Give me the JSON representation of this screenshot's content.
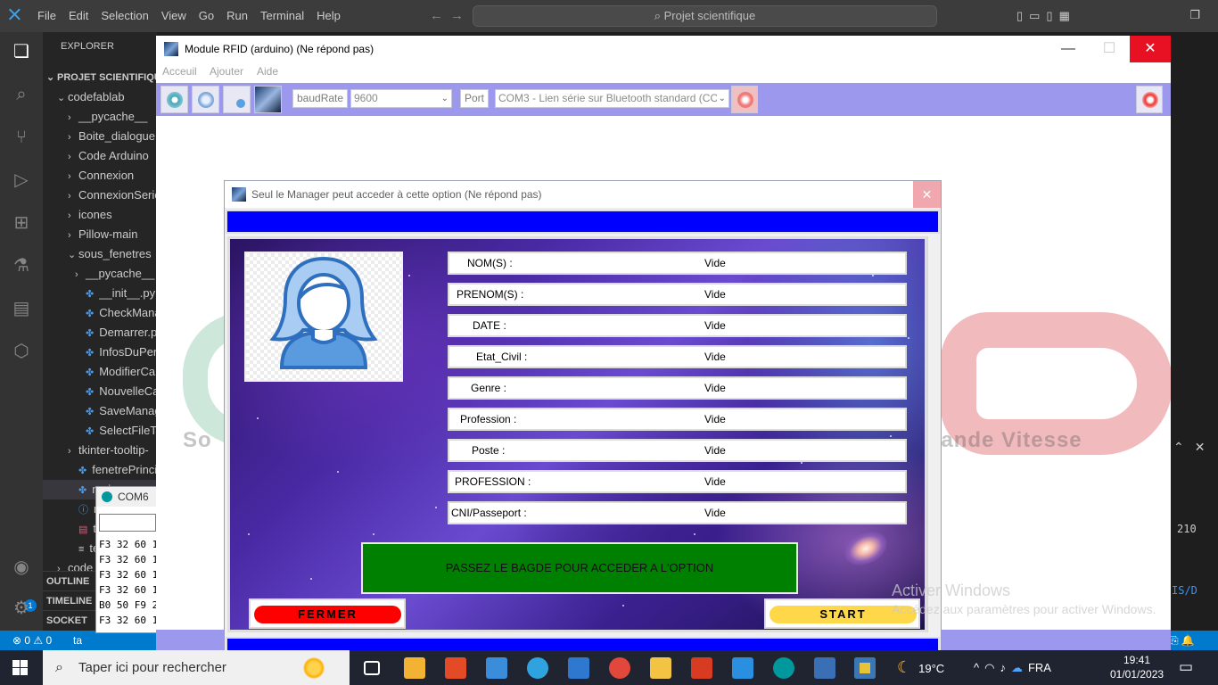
{
  "vscode": {
    "menu": [
      "File",
      "Edit",
      "Selection",
      "View",
      "Go",
      "Run",
      "Terminal",
      "Help"
    ],
    "search_text": "Projet scientifique",
    "explorer_header": "EXPLORER",
    "tree": [
      {
        "label": "PROJET SCIENTIFIQUE",
        "chev": "⌄",
        "indent": 4,
        "bold": true
      },
      {
        "label": "codefablab",
        "chev": "⌄",
        "indent": 16
      },
      {
        "label": "__pycache__",
        "chev": "›",
        "indent": 28
      },
      {
        "label": "Boite_dialogue",
        "chev": "›",
        "indent": 28
      },
      {
        "label": "Code Arduino",
        "chev": "›",
        "indent": 28
      },
      {
        "label": "Connexion",
        "chev": "›",
        "indent": 28
      },
      {
        "label": "ConnexionSerie",
        "chev": "›",
        "indent": 28
      },
      {
        "label": "icones",
        "chev": "›",
        "indent": 28
      },
      {
        "label": "Pillow-main",
        "chev": "›",
        "indent": 28
      },
      {
        "label": "sous_fenetres",
        "chev": "⌄",
        "indent": 28
      },
      {
        "label": "__pycache__",
        "chev": "›",
        "indent": 36
      },
      {
        "label": "__init__.py",
        "chev": "",
        "indent": 36,
        "py": true
      },
      {
        "label": "CheckManager",
        "chev": "",
        "indent": 36,
        "py": true
      },
      {
        "label": "Demarrer.py",
        "chev": "",
        "indent": 36,
        "py": true
      },
      {
        "label": "InfosDuPerso",
        "chev": "",
        "indent": 36,
        "py": true
      },
      {
        "label": "ModifierCarte",
        "chev": "",
        "indent": 36,
        "py": true
      },
      {
        "label": "NouvelleCarte",
        "chev": "",
        "indent": 36,
        "py": true
      },
      {
        "label": "SaveManager",
        "chev": "",
        "indent": 36,
        "py": true
      },
      {
        "label": "SelectFileToRe",
        "chev": "",
        "indent": 36,
        "py": true
      },
      {
        "label": "tkinter-tooltip-",
        "chev": "›",
        "indent": 28
      },
      {
        "label": "fenetrePrincipa",
        "chev": "",
        "indent": 28,
        "py": true
      },
      {
        "label": "main.py",
        "chev": "",
        "indent": 28,
        "py": true,
        "selected": true
      },
      {
        "label": "rea",
        "chev": "",
        "indent": 28,
        "info": true
      },
      {
        "label": "tes",
        "chev": "",
        "indent": 28,
        "db": true
      },
      {
        "label": "tes",
        "chev": "",
        "indent": 28,
        "lines": true
      },
      {
        "label": "code",
        "chev": "›",
        "indent": 16
      }
    ],
    "sections": [
      "OUTLINE",
      "TIMELINE",
      "SOCKET"
    ],
    "status_left": "⊗ 0 ⚠ 0",
    "status_extra": "ta",
    "panel_number": "210",
    "panel_link": "IS/D",
    "activity_badge": "1"
  },
  "serial_monitor": {
    "title": "COM6",
    "lines": [
      "F3 32 60 1",
      "F3 32 60 1",
      "F3 32 60 1",
      "F3 32 60 1",
      "B0 50 F9 2",
      "F3 32 60 1"
    ]
  },
  "rfid_window": {
    "title": "Module RFID  (arduino) (Ne répond pas)",
    "menu": [
      "Acceuil",
      "Ajouter",
      "Aide"
    ],
    "toolbar": {
      "baudrate_label": "baudRate",
      "baudrate_value": "9600",
      "port_label": "Port",
      "port_value": "COM3 - Lien série sur Bluetooth standard (CO"
    },
    "watermark_left": "So",
    "watermark_right": "rande Vitesse"
  },
  "dialog": {
    "title": "Seul le Manager peut acceder à cette option (Ne répond pas)",
    "close_label": "✕",
    "fields": [
      {
        "label": "NOM(S) :",
        "value": "Vide",
        "pad": 18
      },
      {
        "label": "PRENOM(S) :",
        "value": "Vide",
        "pad": 6
      },
      {
        "label": "DATE :",
        "value": "Vide",
        "pad": 24
      },
      {
        "label": "Etat_Civil :",
        "value": "Vide",
        "pad": 28
      },
      {
        "label": "Genre :",
        "value": "Vide",
        "pad": 22
      },
      {
        "label": "Profession :",
        "value": "Vide",
        "pad": 10
      },
      {
        "label": "Poste :",
        "value": "Vide",
        "pad": 23
      },
      {
        "label": "PROFESSION :",
        "value": "Vide",
        "pad": 4
      },
      {
        "label": "CNI/Passeport :",
        "value": "Vide",
        "pad": 0
      }
    ],
    "pass_badge_text": "PASSEZ LE BAGDE POUR ACCEDER A L'OPTION",
    "close_button": "FERMER",
    "start_button": "START"
  },
  "windows_activation": {
    "line1": "Activer Windows",
    "line2": "Accédez aux paramètres pour activer Windows."
  },
  "taskbar": {
    "search_placeholder": "Taper ici pour rechercher",
    "weather": "19°C",
    "language": "FRA",
    "time": "19:41",
    "date": "01/01/2023",
    "apps": [
      {
        "name": "task-view",
        "color": "#ffffff"
      },
      {
        "name": "store",
        "color": "#f2b233"
      },
      {
        "name": "office",
        "color": "#e34b26"
      },
      {
        "name": "photos",
        "color": "#3b8ddc"
      },
      {
        "name": "edge",
        "color": "#2fa3e0"
      },
      {
        "name": "mail",
        "color": "#2f78d0"
      },
      {
        "name": "chrome",
        "color": "#e2473b"
      },
      {
        "name": "file-explorer",
        "color": "#f3c443"
      },
      {
        "name": "office-2",
        "color": "#d73c22"
      },
      {
        "name": "vscode",
        "color": "#2a8fdf"
      },
      {
        "name": "arduino",
        "color": "#00979d"
      },
      {
        "name": "snipping",
        "color": "#3b6fb5"
      },
      {
        "name": "python",
        "color": "#e6c338"
      }
    ]
  },
  "colors": {
    "toolbar_purple": "#9b98ee",
    "dialog_blue": "#0000ff",
    "pass_green": "#008000",
    "fermer_red": "#ff0000",
    "start_yellow": "#ffd84a",
    "vs_status_blue": "#007acc"
  }
}
